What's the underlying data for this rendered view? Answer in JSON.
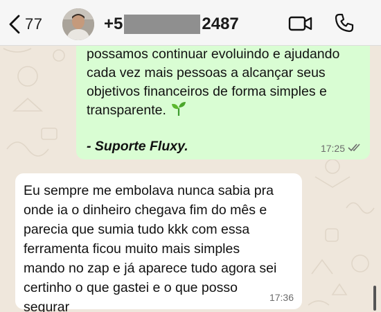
{
  "header": {
    "back_count": "77",
    "contact_prefix": "+5",
    "contact_suffix": "2487"
  },
  "messages": [
    {
      "direction": "outgoing",
      "text": "possamos continuar evoluindo e ajudando\ncada vez mais pessoas a alcançar seus\nobjetivos financeiros de forma simples e\ntransparente.",
      "signature": "- Suporte Fluxy.",
      "time": "17:25",
      "status_icon": "double-check-icon"
    },
    {
      "direction": "incoming",
      "text": "Eu sempre me embolava nunca sabia pra\nonde ia o dinheiro chegava fim do mês e\nparecia que sumia tudo kkk com essa\nferramenta ficou muito mais simples\nmando no zap e já aparece tudo agora sei\ncertinho o que gastei e o que posso\nsegurar",
      "time": "17:36"
    }
  ],
  "colors": {
    "outgoing_bubble": "#d9fdd3",
    "incoming_bubble": "#ffffff",
    "chat_background": "#efe7dc",
    "header_background": "#f6f6f6"
  },
  "icons": {
    "back": "chevron-left-icon",
    "video": "video-camera-icon",
    "call": "phone-icon",
    "emoji": "seedling-emoji"
  }
}
